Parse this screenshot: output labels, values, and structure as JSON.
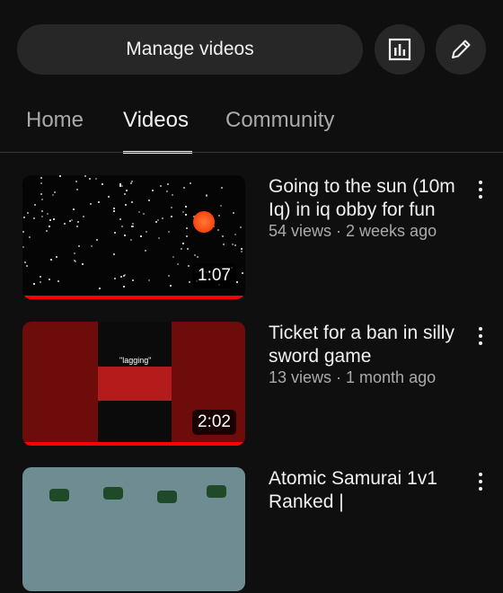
{
  "header": {
    "manage_label": "Manage videos",
    "analytics_icon": "analytics-icon",
    "edit_icon": "pencil-icon"
  },
  "tabs": [
    {
      "label": "Home"
    },
    {
      "label": "Videos"
    },
    {
      "label": "Community"
    }
  ],
  "videos": [
    {
      "title": "Going to the sun (10m Iq) in iq obby for fun",
      "meta": "54 views · 2 weeks ago",
      "duration": "1:07",
      "progress": 1.0
    },
    {
      "title": "Ticket for a ban in silly sword game",
      "meta": "13 views · 1 month ago",
      "duration": "2:02",
      "progress": 1.0,
      "thumb_caption": "\"lagging\""
    },
    {
      "title": "Atomic Samurai 1v1 Ranked |",
      "meta": "",
      "duration": ""
    }
  ],
  "colors": {
    "background": "#0f0f0f",
    "button": "#272727",
    "progress": "#ff0000",
    "secondary_text": "#aaaaaa"
  }
}
